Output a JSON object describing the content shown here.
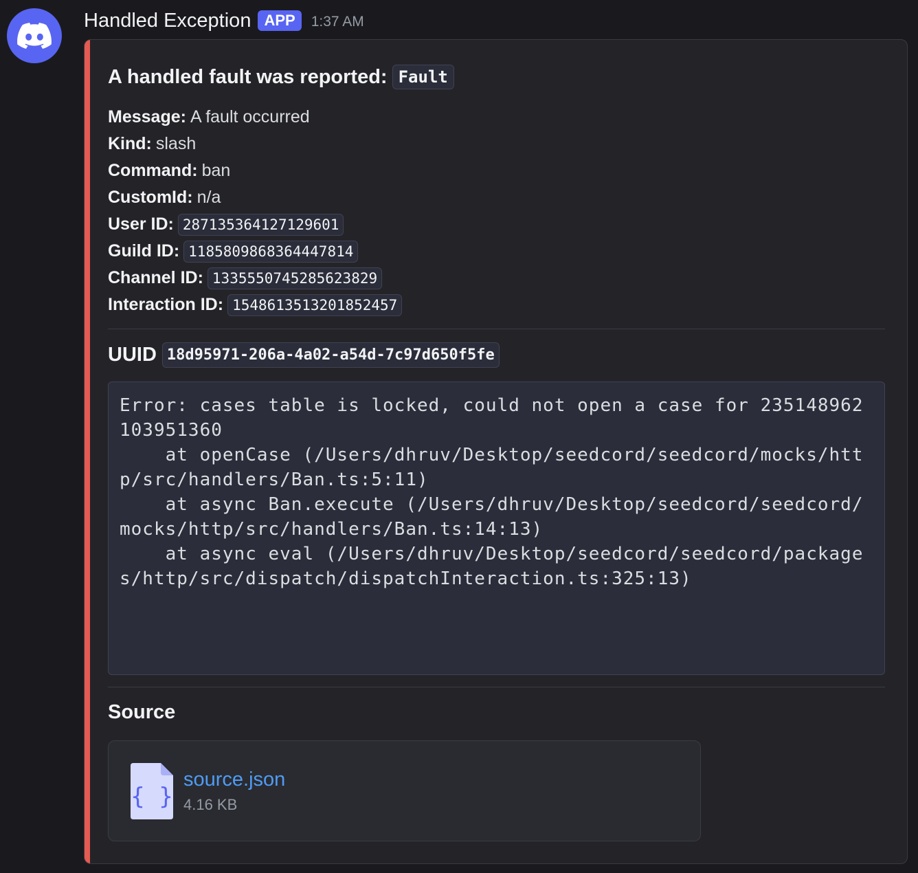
{
  "author": {
    "avatar_icon": "discord-logo-icon",
    "name": "Handled Exception",
    "badge": "APP",
    "timestamp": "1:37 AM"
  },
  "embed": {
    "accent_color": "#e55a52",
    "title_text": "A handled fault was reported:",
    "title_code": "Fault",
    "fields": [
      {
        "label": "Message:",
        "value": "A fault occurred",
        "code": false
      },
      {
        "label": "Kind:",
        "value": "slash",
        "code": false
      },
      {
        "label": "Command:",
        "value": "ban",
        "code": false
      },
      {
        "label": "CustomId:",
        "value": "n/a",
        "code": false
      },
      {
        "label": "User ID:",
        "value": "287135364127129601",
        "code": true
      },
      {
        "label": "Guild ID:",
        "value": "1185809868364447814",
        "code": true
      },
      {
        "label": "Channel ID:",
        "value": "1335550745285623829",
        "code": true
      },
      {
        "label": "Interaction ID:",
        "value": "1548613513201852457",
        "code": true
      }
    ],
    "uuid_label": "UUID",
    "uuid_value": "18d95971-206a-4a02-a54d-7c97d650f5fe",
    "stack_trace": "Error: cases table is locked, could not open a case for 235148962103951360\n    at openCase (/Users/dhruv/Desktop/seedcord/seedcord/mocks/http/src/handlers/Ban.ts:5:11)\n    at async Ban.execute (/Users/dhruv/Desktop/seedcord/seedcord/mocks/http/src/handlers/Ban.ts:14:13)\n    at async eval (/Users/dhruv/Desktop/seedcord/seedcord/packages/http/src/dispatch/dispatchInteraction.ts:325:13)",
    "source_title": "Source",
    "attachment": {
      "icon": "json-file-icon",
      "name": "source.json",
      "size": "4.16 KB"
    }
  }
}
